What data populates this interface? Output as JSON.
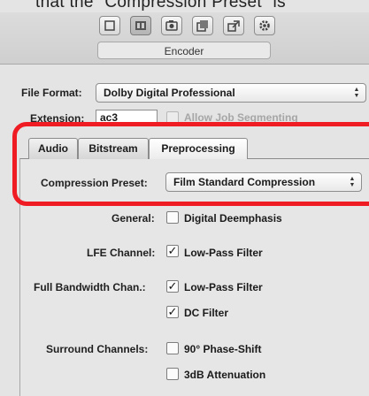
{
  "caption": "that the \"Compression Preset\" is",
  "toolbar": {
    "buttons": [
      {
        "name": "summary-icon",
        "selected": false
      },
      {
        "name": "encoder-icon",
        "selected": true
      },
      {
        "name": "frame-controls-icon",
        "selected": false
      },
      {
        "name": "filters-icon",
        "selected": false
      },
      {
        "name": "geometry-icon",
        "selected": false
      },
      {
        "name": "actions-icon",
        "selected": false
      }
    ],
    "section_label": "Encoder"
  },
  "file_format": {
    "label": "File Format:",
    "value": "Dolby Digital Professional"
  },
  "extension": {
    "label": "Extension:",
    "value": "ac3",
    "allow_segmenting_label": "Allow Job Segmenting"
  },
  "tabs": [
    {
      "label": "Audio",
      "active": false
    },
    {
      "label": "Bitstream",
      "active": false
    },
    {
      "label": "Preprocessing",
      "active": true
    }
  ],
  "compression_preset": {
    "label": "Compression Preset:",
    "value": "Film Standard Compression"
  },
  "general": {
    "label": "General:",
    "option": "Digital Deemphasis",
    "checked": false
  },
  "lfe": {
    "label": "LFE Channel:",
    "option": "Low-Pass Filter",
    "checked": true
  },
  "full_bandwidth": {
    "label": "Full Bandwidth Chan.:",
    "options": [
      {
        "label": "Low-Pass Filter",
        "checked": true
      },
      {
        "label": "DC Filter",
        "checked": true
      }
    ]
  },
  "surround": {
    "label": "Surround Channels:",
    "options": [
      {
        "label": "90° Phase-Shift",
        "checked": false
      },
      {
        "label": "3dB Attenuation",
        "checked": false
      }
    ]
  },
  "check_glyph": "✓",
  "highlight_color": "#ef1c24"
}
